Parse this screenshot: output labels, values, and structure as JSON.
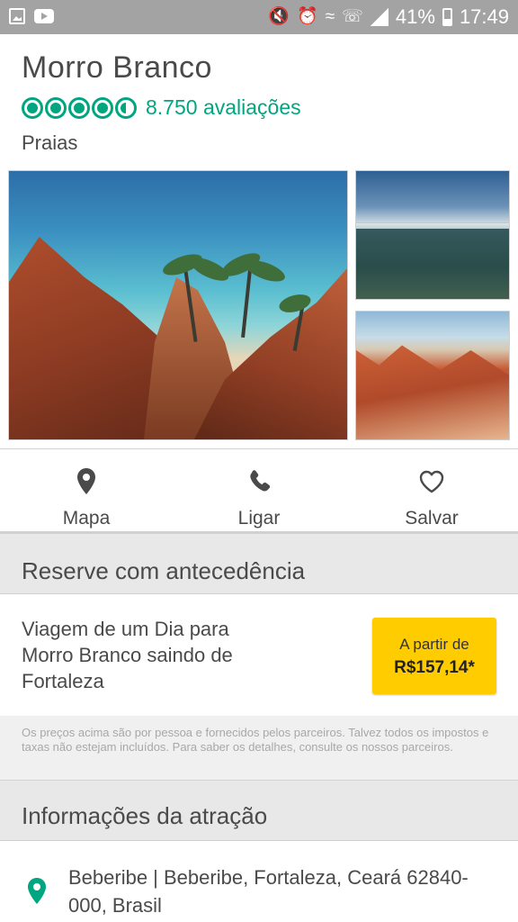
{
  "status_bar": {
    "battery": "41%",
    "time": "17:49",
    "icons": [
      "image-notification-icon",
      "youtube-icon",
      "mute-icon",
      "alarm-icon",
      "wifi-icon",
      "phone-icon",
      "signal-icon",
      "battery-icon"
    ]
  },
  "attraction": {
    "name": "Morro Branco",
    "rating_bubbles": 4.5,
    "reviews": "8.750 avaliações",
    "category": "Praias"
  },
  "actions": [
    {
      "label": "Mapa",
      "icon": "map-pin-icon"
    },
    {
      "label": "Ligar",
      "icon": "phone-icon"
    },
    {
      "label": "Salvar",
      "icon": "heart-icon"
    }
  ],
  "booking": {
    "header": "Reserve com antecedência",
    "tour_title": "Viagem de um Dia para Morro Branco saindo de Fortaleza",
    "price_prefix": "A partir de",
    "price": "R$157,14*",
    "disclaimer": "Os preços acima são por pessoa e fornecidos pelos parceiros. Talvez todos os impostos e taxas não estejam incluídos. Para saber os detalhes, consulte os nossos parceiros."
  },
  "info": {
    "header": "Informações da atração",
    "address": "Beberibe | Beberibe, Fortaleza, Ceará 62840-000, Brasil"
  },
  "colors": {
    "brand_green": "#00a680",
    "price_button": "#ffcc00",
    "status_bar": "#a3a3a3"
  }
}
